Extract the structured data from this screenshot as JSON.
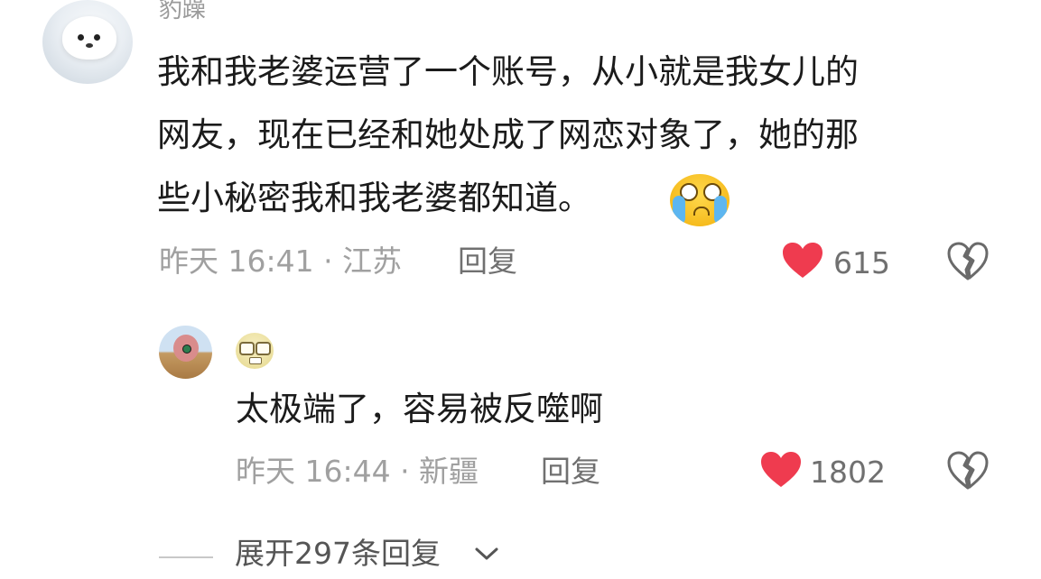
{
  "comment": {
    "username": "豹躁",
    "text_lines": [
      "我和我老婆运营了一个账号，从小就是我女儿的",
      "网友，现在已经和她处成了网恋对象了，她的那",
      "些小秘密我和我老婆都知道。"
    ],
    "emoji": "cry-laugh-emoji",
    "meta": "昨天 16:41 · 江苏",
    "reply_label": "回复",
    "like_count": "615"
  },
  "reply": {
    "username_emoji": "nerd-face-emoji",
    "text": "太极端了，容易被反噬啊",
    "meta": "昨天 16:44 · 新疆",
    "reply_label": "回复",
    "like_count": "1802"
  },
  "expand": {
    "label": "展开297条回复",
    "icon": "chevron-down-icon"
  },
  "colors": {
    "like_heart": "#ef3b4f",
    "meta_text": "#a0a0a0"
  }
}
